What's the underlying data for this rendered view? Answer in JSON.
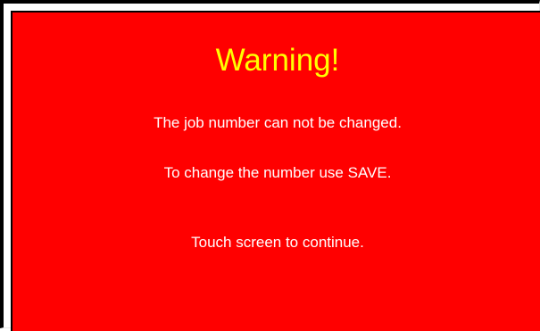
{
  "dialog": {
    "title": "Warning!",
    "message_1": "The job number can not be changed.",
    "message_2": "To change the number use SAVE.",
    "instruction": "Touch screen to continue."
  },
  "colors": {
    "background": "#ff0000",
    "title": "#ffff00",
    "text": "#ffffff",
    "border": "#000000"
  }
}
